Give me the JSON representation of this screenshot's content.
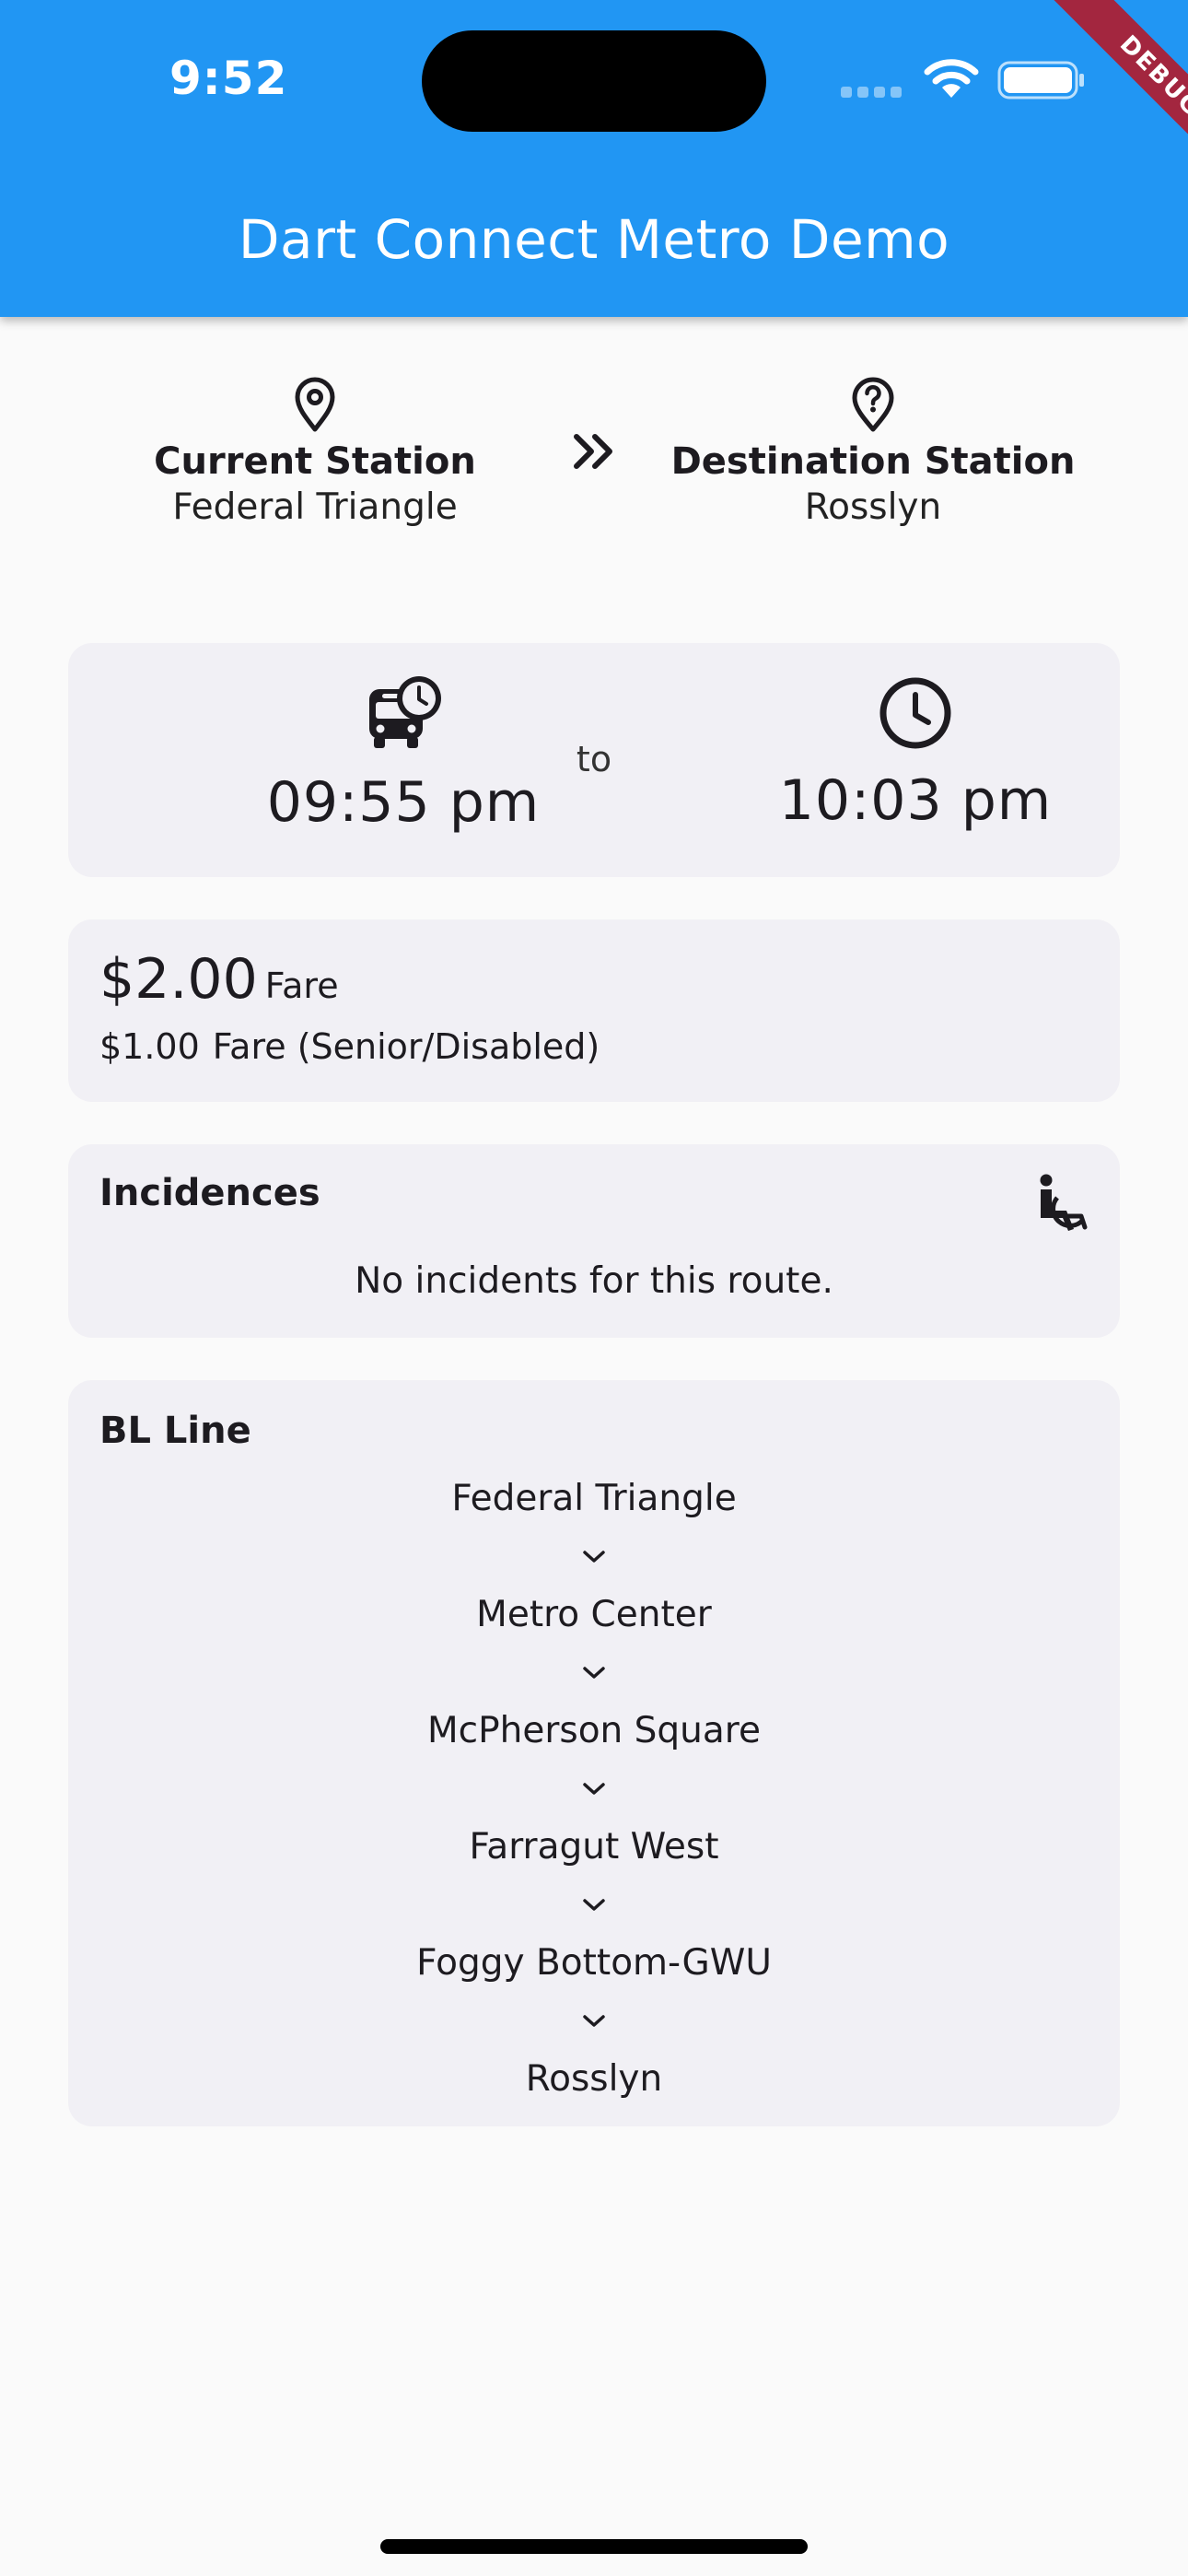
{
  "status_bar": {
    "time": "9:52"
  },
  "debug_banner": "DEBUG",
  "app_bar": {
    "title": "Dart Connect Metro Demo"
  },
  "route": {
    "current": {
      "title": "Current Station",
      "name": "Federal Triangle"
    },
    "destination": {
      "title": "Destination Station",
      "name": "Rosslyn"
    }
  },
  "times": {
    "departure": "09:55 pm",
    "to": "to",
    "arrival": "10:03 pm"
  },
  "fare": {
    "amount": "$2.00",
    "label": "Fare",
    "reduced_amount": "$1.00",
    "reduced_label": "Fare (Senior/Disabled)"
  },
  "incidences": {
    "title": "Incidences",
    "message": "No incidents for this route."
  },
  "line": {
    "title": "BL Line",
    "stops": [
      "Federal Triangle",
      "Metro Center",
      "McPherson Square",
      "Farragut West",
      "Foggy Bottom-GWU",
      "Rosslyn"
    ]
  },
  "icons": {
    "current": "location-pin-icon",
    "destination": "location-question-icon",
    "arrow": "double-chevron-right-icon",
    "departure": "bus-clock-icon",
    "arrival": "clock-icon",
    "accessibility": "wheelchair-icon"
  },
  "colors": {
    "app_bar": "#2196f3",
    "card": "#f1f0f5",
    "debug": "#a3263f"
  }
}
